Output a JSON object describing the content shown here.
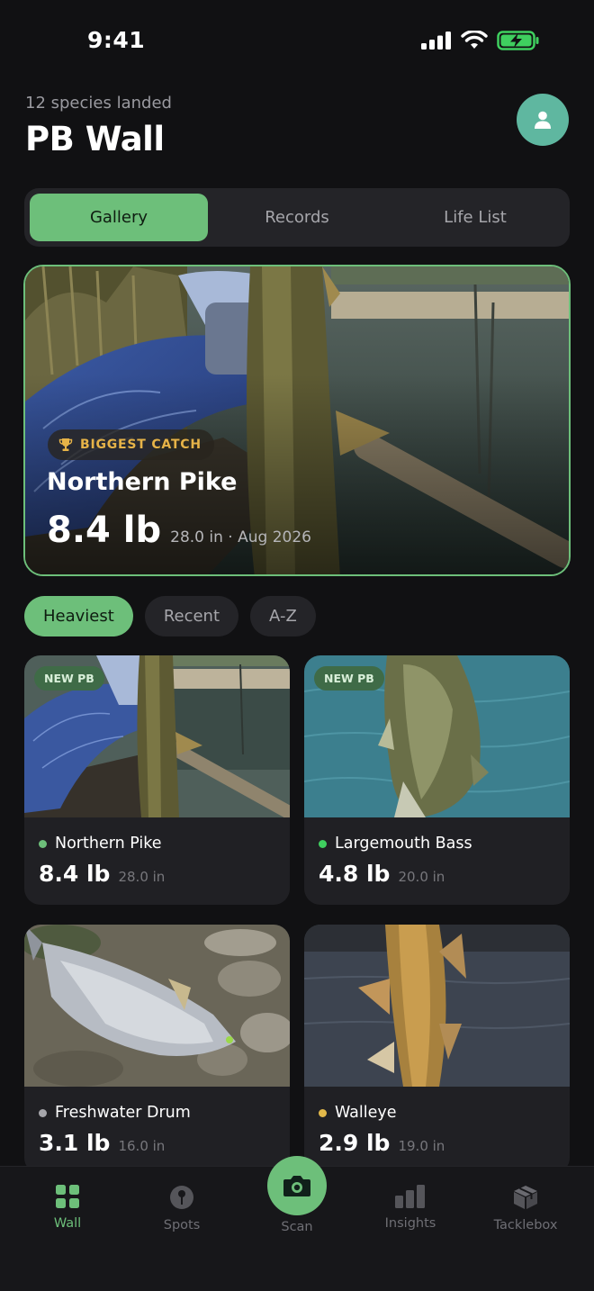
{
  "status_bar": {
    "time": "9:41"
  },
  "header": {
    "subtitle": "12 species landed",
    "title": "PB Wall"
  },
  "tabs": [
    {
      "label": "Gallery"
    },
    {
      "label": "Records"
    },
    {
      "label": "Life List"
    }
  ],
  "hero": {
    "badge": "BIGGEST CATCH",
    "species": "Northern Pike",
    "weight": "8.4 lb",
    "meta": "28.0 in · Aug 2026"
  },
  "filters": [
    {
      "label": "Heaviest"
    },
    {
      "label": "Recent"
    },
    {
      "label": "A-Z"
    }
  ],
  "cards": [
    {
      "badge": "NEW PB",
      "species": "Northern Pike",
      "weight": "8.4 lb",
      "length": "28.0 in",
      "dot_color": "#6dbf7a"
    },
    {
      "badge": "NEW PB",
      "species": "Largemouth Bass",
      "weight": "4.8 lb",
      "length": "20.0 in",
      "dot_color": "#3fcf5f"
    },
    {
      "badge": "",
      "species": "Freshwater Drum",
      "weight": "3.1 lb",
      "length": "16.0 in",
      "dot_color": "#a6a6ab"
    },
    {
      "badge": "",
      "species": "Walleye",
      "weight": "2.9 lb",
      "length": "19.0 in",
      "dot_color": "#e2b84a"
    }
  ],
  "nav": [
    {
      "label": "Wall",
      "icon": "grid-icon"
    },
    {
      "label": "Spots",
      "icon": "pin-icon"
    },
    {
      "label": "Scan",
      "icon": "camera-icon"
    },
    {
      "label": "Insights",
      "icon": "bar-chart-icon"
    },
    {
      "label": "Tacklebox",
      "icon": "box-icon"
    }
  ],
  "colors": {
    "accent": "#6dbf7a",
    "background": "#111113",
    "badge_gold": "#e6b348"
  }
}
